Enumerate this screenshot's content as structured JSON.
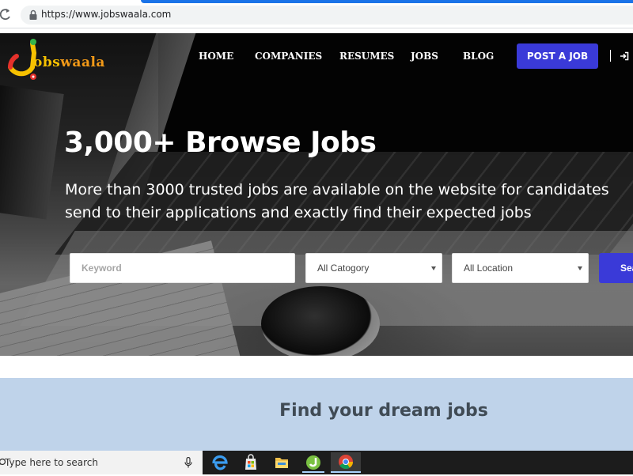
{
  "browser": {
    "url": "https://www.jobswaala.com"
  },
  "site": {
    "logo_text_a": "obs",
    "logo_text_b": "waala",
    "nav": [
      {
        "label": "HOME"
      },
      {
        "label": "COMPANIES"
      },
      {
        "label": "RESUMES"
      },
      {
        "label": "JOBS"
      },
      {
        "label": "BLOG"
      }
    ],
    "post_job_label": "POST A JOB"
  },
  "hero": {
    "title": "3,000+ Browse Jobs",
    "subtitle_line1": "More than 3000 trusted jobs are available on the website for candidates",
    "subtitle_line2": "send to their applications and exactly find their expected jobs"
  },
  "search": {
    "keyword_placeholder": "Keyword",
    "category_selected": "All Catogory",
    "location_selected": "All Location",
    "button_label": "Search"
  },
  "dream": {
    "title": "Find your dream jobs"
  },
  "taskbar": {
    "search_placeholder": "Type here to search",
    "pinned": [
      "edge-icon",
      "store-icon",
      "file-explorer-icon",
      "jobswaala-app-icon",
      "chrome-icon"
    ]
  },
  "colors": {
    "brand_blue": "#3a3ad8",
    "dream_bg": "#bfd3ea",
    "logo_yellow": "#f6c100",
    "logo_red": "#e5312b",
    "logo_green": "#35b44a"
  }
}
